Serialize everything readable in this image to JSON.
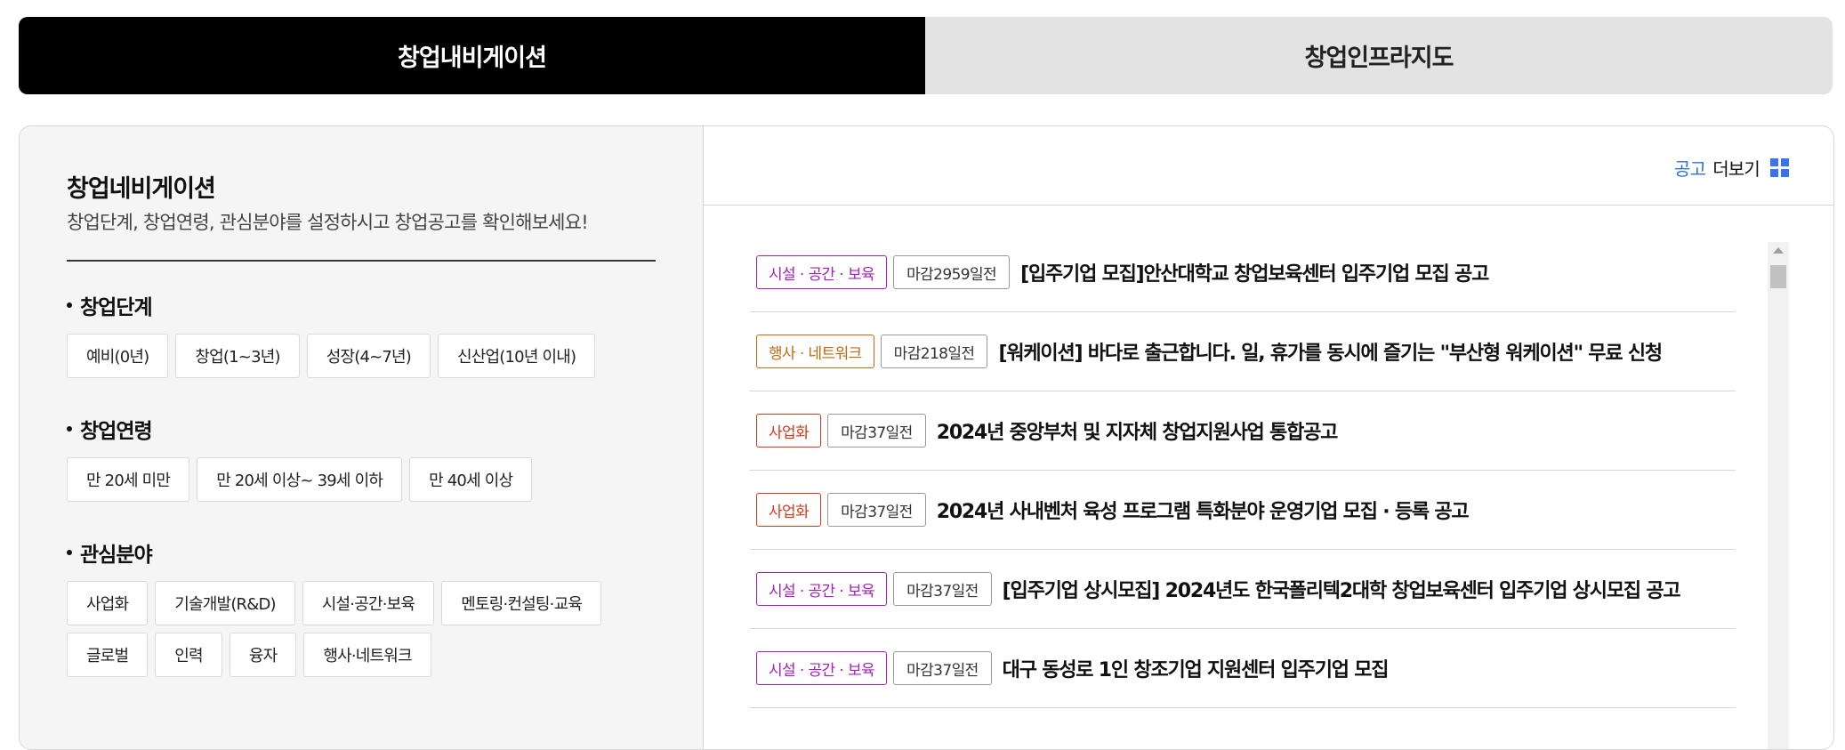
{
  "tabs": [
    {
      "label": "창업내비게이션",
      "active": true
    },
    {
      "label": "창업인프라지도",
      "active": false
    }
  ],
  "navigation": {
    "title": "창업네비게이션",
    "description": "창업단계, 창업연령, 관심분야를 설정하시고 창업공고를 확인해보세요!",
    "stage": {
      "title": "창업단계",
      "options": [
        "예비(0년)",
        "창업(1~3년)",
        "성장(4~7년)",
        "신산업(10년 이내)"
      ]
    },
    "age": {
      "title": "창업연령",
      "options": [
        "만 20세 미만",
        "만 20세 이상~ 39세 이하",
        "만 40세 이상"
      ]
    },
    "interest": {
      "title": "관심분야",
      "options": [
        "사업화",
        "기술개발(R&D)",
        "시설·공간·보육",
        "멘토링·컨설팅·교육",
        "글로벌",
        "인력",
        "융자",
        "행사·네트워크"
      ]
    }
  },
  "announcements": {
    "more_prefix": "공고",
    "more_label": "더보기",
    "more_icon": "grid-icon",
    "items": [
      {
        "category": "시설 · 공간 · 보육",
        "category_color": "purple",
        "deadline": "마감2959일전",
        "title": "[입주기업 모집]안산대학교 창업보육센터 입주기업 모집 공고"
      },
      {
        "category": "행사 · 네트워크",
        "category_color": "orange",
        "deadline": "마감218일전",
        "title": "[워케이션] 바다로 출근합니다. 일, 휴가를 동시에 즐기는 \"부산형 워케이션\" 무료 신청"
      },
      {
        "category": "사업화",
        "category_color": "red",
        "deadline": "마감37일전",
        "title": "2024년 중앙부처 및 지자체 창업지원사업 통합공고"
      },
      {
        "category": "사업화",
        "category_color": "red",
        "deadline": "마감37일전",
        "title": "2024년 사내벤처 육성 프로그램 특화분야 운영기업 모집 · 등록 공고"
      },
      {
        "category": "시설 · 공간 · 보육",
        "category_color": "purple",
        "deadline": "마감37일전",
        "title": "[입주기업 상시모집] 2024년도 한국폴리텍2대학 창업보육센터 입주기업 상시모집 공고"
      },
      {
        "category": "시설 · 공간 · 보육",
        "category_color": "purple",
        "deadline": "마감37일전",
        "title": "대구 동성로 1인 창조기업 지원센터 입주기업 모집"
      }
    ]
  },
  "colors": {
    "purple": "#a321b8",
    "orange": "#c26a10",
    "red": "#d33a1c",
    "accent": "#2f6fe0"
  }
}
